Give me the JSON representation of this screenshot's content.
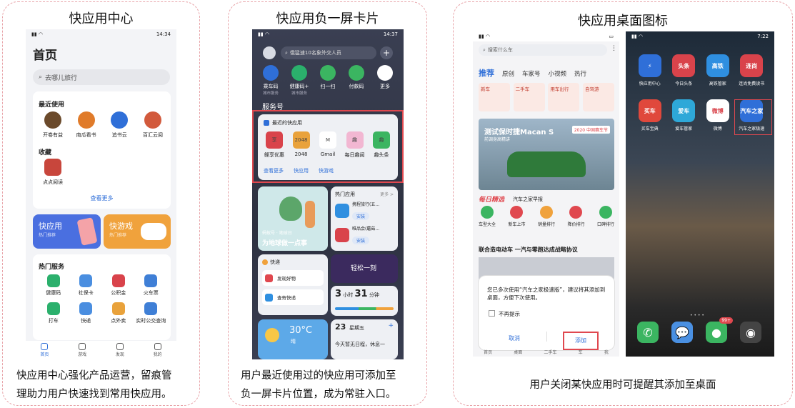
{
  "panel1": {
    "title": "快应用中心",
    "caption": [
      "快应用中心强化产品运营，留痕管",
      "理助力用户快速找到常用快应用。"
    ],
    "status_time": "14:34",
    "page_title": "首页",
    "search_placeholder": "去哪儿旅行",
    "recent_title": "最近使用",
    "recent_apps": [
      {
        "label": "开卷有益",
        "color": "#6b4a2b",
        "icon": "book-icon"
      },
      {
        "label": "南瓜看书",
        "color": "#e07b2a",
        "icon": "pumpkin-icon"
      },
      {
        "label": "追书云",
        "color": "#2f6fd8",
        "icon": "cloud-book-icon"
      },
      {
        "label": "百汇云阅",
        "color": "#d25a3c",
        "icon": "reader-icon"
      }
    ],
    "fav_title": "收藏",
    "fav_apps": [
      {
        "label": "点点阅读",
        "color": "#c8463c",
        "icon": "read-icon"
      }
    ],
    "see_more": "查看更多",
    "banner_quick": {
      "title": "快应用",
      "sub": "热门推荐"
    },
    "banner_game": {
      "title": "快游戏",
      "sub": "热门推荐"
    },
    "hot_title": "热门服务",
    "hot_services": [
      {
        "label": "健康码",
        "color": "#2bb06c"
      },
      {
        "label": "社保卡",
        "color": "#4a8ee0"
      },
      {
        "label": "公积金",
        "color": "#d9434b"
      },
      {
        "label": "火车票",
        "color": "#3f7fd6"
      },
      {
        "label": "打车",
        "color": "#2bb06c"
      },
      {
        "label": "快递",
        "color": "#4a8ee0"
      },
      {
        "label": "点外卖",
        "color": "#e9a23b"
      },
      {
        "label": "实时公交查询",
        "color": "#3f7fd6"
      }
    ],
    "nav": [
      {
        "label": "首页",
        "icon": "home-icon",
        "active": true
      },
      {
        "label": "游戏",
        "icon": "gamepad-icon",
        "active": false
      },
      {
        "label": "发现",
        "icon": "discover-icon",
        "active": false
      },
      {
        "label": "我的",
        "icon": "profile-icon",
        "active": false
      }
    ]
  },
  "panel2": {
    "title": "快应用负一屏卡片",
    "caption": [
      "用户最近使用过的快应用可添加至",
      "负一屏卡片位置，成为常驻入口。"
    ],
    "status_time": "14:37",
    "search_placeholder": "俄猛速10名象外交人员",
    "services": [
      {
        "label": "乘车码",
        "sub": "城市服务",
        "color": "#2f6fd8"
      },
      {
        "label": "健康码+",
        "sub": "城市服务",
        "color": "#2bb06c"
      },
      {
        "label": "扫一扫",
        "sub": "",
        "color": "#3bb561"
      },
      {
        "label": "付款码",
        "sub": "",
        "color": "#3bb561"
      },
      {
        "label": "更多",
        "sub": "",
        "color": "#ffffff"
      }
    ],
    "section_label": "服务号",
    "recent_card_title": "最近的快应用",
    "recent_apps": [
      {
        "label": "鲣享优惠",
        "color": "#d9434b",
        "glyph": "享"
      },
      {
        "label": "2048",
        "color": "#e9a23b",
        "glyph": "2048"
      },
      {
        "label": "Gmail",
        "color": "#ffffff",
        "glyph": "M"
      },
      {
        "label": "每日趣闻",
        "color": "#f2b7d2",
        "glyph": "趣"
      },
      {
        "label": "趣头条",
        "color": "#3bb561",
        "glyph": "趣"
      }
    ],
    "links": [
      "查看更多",
      "快应用",
      "快游戏"
    ],
    "tree_card": {
      "line1": "蚂蚁号 · 地球日",
      "line2": "为地球做一点事"
    },
    "hot_apps_title": "热门应用",
    "hot_apps_more": "更多 >",
    "hot_apps": [
      {
        "name": "携程旅行(五...",
        "btn": "安装",
        "color": "#2f8fe0"
      },
      {
        "name": "唯品会(蘑菇...",
        "btn": "安装",
        "color": "#d9434b"
      }
    ],
    "express_title": "快递",
    "express_items": [
      "发现好物",
      "查寄快递"
    ],
    "video_label": "轻松一刻",
    "time_card": {
      "h": "3",
      "hu": "小时",
      "m": "31",
      "mu": "分钟"
    },
    "weather": {
      "temp": "30°C",
      "desc": "晴"
    },
    "date_card": {
      "day": "23",
      "weekday": "星期五",
      "note": "今天暂无日程，休息一"
    }
  },
  "panel3": {
    "title": "快应用桌面图标",
    "caption": "用户关闭某快应用时可提醒其添加至桌面",
    "left_status_time": "",
    "search_placeholder": "搜索什么车",
    "tabs": [
      "推荐",
      "原创",
      "车家号",
      "小视频",
      "热行"
    ],
    "chips": [
      "新车",
      "二手车",
      "用车出行",
      "自驾游"
    ],
    "banner_line1": "测试保时捷Macan S",
    "banner_line2": "前调身高精讲",
    "banner_tag": "2020 中国赛车节",
    "daily_title": "每日精选",
    "daily_sub": "汽车之家早报",
    "daily_icons": [
      "车型大全",
      "新车上市",
      "销量排行",
      "降价排行",
      "口碑排行"
    ],
    "news_title": "联合造电动车 一汽与零跑达成战略协议",
    "dialog_text": "您已多次使用“汽车之家极速版”，建议将其添加到桌面，方便下次使用。",
    "dialog_checkbox": "不再提示",
    "dialog_cancel": "取消",
    "dialog_add": "添加",
    "bottom_nav": [
      "首页",
      "桌面",
      "二手车",
      "车",
      "我"
    ],
    "right_status_time": "7:22",
    "home_icons": [
      {
        "label": "快应用中心",
        "color": "#2f6fd8",
        "glyph": "⚡"
      },
      {
        "label": "今日头条",
        "color": "#d9434b",
        "glyph": "头条"
      },
      {
        "label": "高铁管家",
        "color": "#2f8fe0",
        "glyph": "高铁"
      },
      {
        "label": "连尚免费读书",
        "color": "#d9434b",
        "glyph": "连尚"
      },
      {
        "label": "买车宝典",
        "color": "#e0483c",
        "glyph": "买车"
      },
      {
        "label": "爱车管家",
        "color": "#2ea8d8",
        "glyph": "爱车"
      },
      {
        "label": "微博",
        "color": "#ffffff",
        "glyph": "微博"
      },
      {
        "label": "汽车之家极速",
        "color": "#2f6fd8",
        "glyph": "汽车之家"
      }
    ],
    "dock": [
      {
        "name": "phone-icon",
        "color": "#3bb561",
        "glyph": "✆"
      },
      {
        "name": "message-icon",
        "color": "#4a90e2",
        "glyph": "💬"
      },
      {
        "name": "wechat-icon",
        "color": "#3bb561",
        "glyph": "●",
        "badge": "99+"
      },
      {
        "name": "camera-icon",
        "color": "#444444",
        "glyph": "◉"
      }
    ]
  }
}
